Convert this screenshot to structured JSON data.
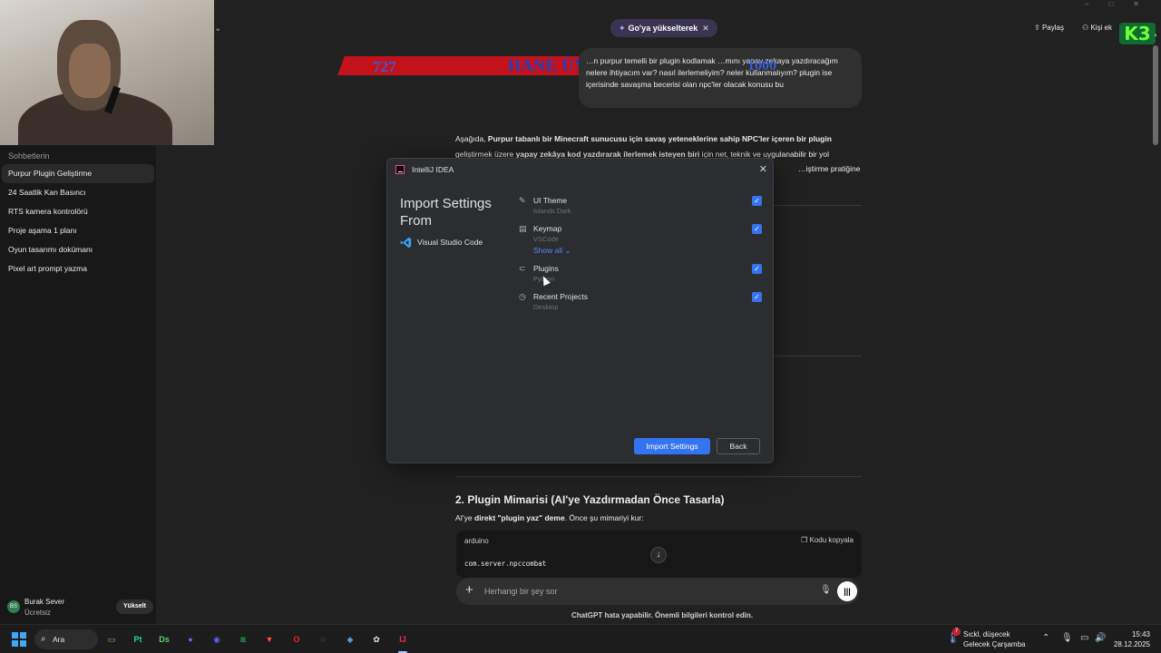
{
  "sidebar": {
    "section_title": "Sohbetlerin",
    "chats": [
      {
        "label": "Purpur Plugin Geliştirme",
        "active": true
      },
      {
        "label": "24 Saatlik Kan Basıncı",
        "active": false
      },
      {
        "label": "RTS kamera kontrolörü",
        "active": false
      },
      {
        "label": "Proje aşama 1 planı",
        "active": false
      },
      {
        "label": "Oyun tasarımı dokümanı",
        "active": false
      },
      {
        "label": "Pixel art prompt yazma",
        "active": false
      }
    ],
    "user": {
      "avatar": "BS",
      "name": "Burak Sever",
      "plan": "Ücretsiz",
      "upgrade_label": "Yükselt"
    }
  },
  "header": {
    "upgrade_pill": "Go'ya yükselterek",
    "share_label": "Paylaş",
    "add_person_label": "Kişi ek"
  },
  "overlay": {
    "banner_number": "727",
    "banner_text": "HANE ÜYELERI",
    "banner_count": "1000",
    "logo_text": "K3"
  },
  "conversation": {
    "user_message": "…n purpur temelli bir plugin kodlamak …mını yapay zekaya yazdıracağım nelere ihtiyacım var? nasıl ilerlemeliyim? neler kullanmalıyım? plugin ise içerisinde savaşma becerisi olan npc'ler olacak konusu bu",
    "response_intro": {
      "p1": "Aşağıda, ",
      "b1": "Purpur tabanlı bir Minecraft sunucusu için savaş yeteneklerine sahip NPC'ler içeren bir plugin",
      "p2": " geliştirmek üzere ",
      "b2": "yapay zekâya kod yazdırarak ilerlemek isteyen biri",
      "p3": " için net, teknik ve uygulanabilir bir yol",
      "tail": "…iştirme pratiğine"
    },
    "section_title": "2. Plugin Mimarisi (AI'ye Yazdırmadan Önce Tasarla)",
    "section_body": {
      "p1": "AI'ye ",
      "b1": "direkt \"plugin yaz\" deme",
      "p2": ". Önce şu mimariyi kur:"
    },
    "code": {
      "lang": "arduino",
      "copy_label": "Kodu kopyala",
      "line": "com.server.npccombat"
    },
    "composer_placeholder": "Herhangi bir şey sor",
    "disclaimer": "ChatGPT hata yapabilir. Önemli bilgileri kontrol edin."
  },
  "dialog": {
    "app_title": "IntelliJ IDEA",
    "heading": "Import Settings From",
    "source": "Visual Studio Code",
    "options": [
      {
        "icon": "brush-icon",
        "glyph": "✎",
        "label": "UI Theme",
        "sub": "Islands Dark",
        "checked": true
      },
      {
        "icon": "keyboard-icon",
        "glyph": "▤",
        "label": "Keymap",
        "sub": "VSCode",
        "checked": true
      },
      {
        "icon": "plug-icon",
        "glyph": "⊂",
        "label": "Plugins",
        "sub": "Python",
        "checked": true
      },
      {
        "icon": "clock-icon",
        "glyph": "◷",
        "label": "Recent Projects",
        "sub": "Desktop",
        "checked": true
      }
    ],
    "show_all": "Show all",
    "import_label": "Import Settings",
    "back_label": "Back"
  },
  "taskbar": {
    "search_label": "Ara",
    "apps": [
      {
        "name": "file-explorer-icon",
        "glyph": "▭",
        "color": "#d9a93a"
      },
      {
        "name": "pycharm-icon",
        "glyph": "Pt",
        "color": "#21d789"
      },
      {
        "name": "datasense-icon",
        "glyph": "Ds",
        "color": "#57d36f"
      },
      {
        "name": "app-icon",
        "glyph": "●",
        "color": "#7a5cf0"
      },
      {
        "name": "discord-icon",
        "glyph": "◉",
        "color": "#5865f2"
      },
      {
        "name": "spotify-icon",
        "glyph": "≋",
        "color": "#1db954"
      },
      {
        "name": "brave-icon",
        "glyph": "▼",
        "color": "#fb542b"
      },
      {
        "name": "opera-icon",
        "glyph": "O",
        "color": "#ff1b2d"
      },
      {
        "name": "app2-icon",
        "glyph": "◌",
        "color": "#bbbbbb"
      },
      {
        "name": "app3-icon",
        "glyph": "◆",
        "color": "#4f9be0"
      },
      {
        "name": "chatgpt-icon",
        "glyph": "✿",
        "color": "#e8e8e8"
      },
      {
        "name": "intellij-icon",
        "glyph": "IJ",
        "color": "#fe2857"
      }
    ],
    "weather_badge": "7",
    "weather_line1": "Sıckl. düşecek",
    "weather_line2": "Gelecek Çarşamba",
    "time": "15:43",
    "date": "28.12.2025"
  },
  "colors": {
    "accent": "#3574f0",
    "background": "#212121",
    "sidebar": "#181818"
  }
}
